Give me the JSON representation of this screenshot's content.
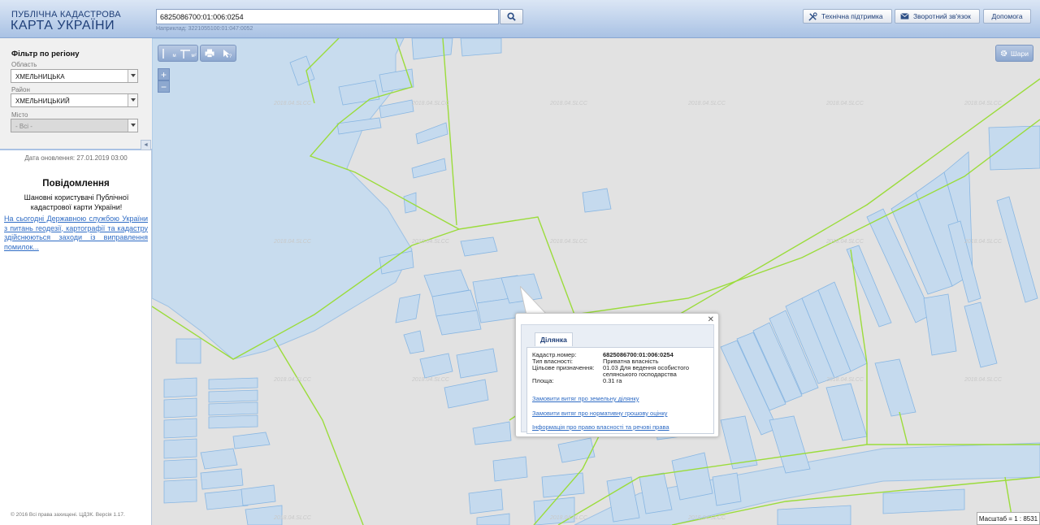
{
  "header": {
    "logo_line1": "ПУБЛІЧНА КАДАСТРОВА",
    "logo_line2": "КАРТА УКРАЇНИ",
    "search_value": "6825086700:01:006:0254",
    "search_example": "Наприклад: 3221055100:01:047:0052",
    "buttons": {
      "support": "Технічна підтримка",
      "feedback": "Зворотний зв'язок",
      "help": "Допомога"
    }
  },
  "sidebar": {
    "filter_title": "Фільтр по регіону",
    "region_label": "Область",
    "region_value": "ХМЕЛЬНИЦЬКА",
    "district_label": "Район",
    "district_value": "ХМЕЛЬНИЦЬКИЙ",
    "city_label": "Місто",
    "city_value": "- Всі -",
    "update_date": "Дата оновлення: 27.01.2019 03:00",
    "notice_title": "Повідомлення",
    "notice_body": "Шановні користувачі Публічної кадастрової карти України!",
    "notice_link": "На сьогодні Державною службою України з питань геодезії, картографії та кадастру здійснюються заходи із виправлення помилок...",
    "footer": "© 2016 Всі права захищені. ЦДЗК. Версія 1.17."
  },
  "map": {
    "tools": {
      "measure_m": "м",
      "measure_m2": "м²"
    },
    "zoom_in": "+",
    "zoom_out": "−",
    "layers": "Шари",
    "watermark": "2018.04.SLCC",
    "scale": "Масштаб = 1 : 8531",
    "popup": {
      "tab": "Ділянка",
      "rows": [
        {
          "key": "Кадастр.номер:",
          "value": "6825086700:01:006:0254"
        },
        {
          "key": "Тип власності:",
          "value": "Приватна власність"
        },
        {
          "key": "Цільове призначення:",
          "value": "01.03 Для ведення особистого селянського господарства"
        },
        {
          "key": "Площа:",
          "value": "0.31 га"
        }
      ],
      "links": [
        "Замовити витяг про земельну ділянку",
        "Замовити витяг про нормативну грошову оцінку",
        "Інформація про право власності та речові права"
      ]
    }
  },
  "colors": {
    "header_top": "#dbe6f5",
    "header_bottom": "#a9c2e4",
    "parcel_fill": "#c5daee",
    "parcel_stroke": "#88b6e2",
    "boundary": "#9bdc3b",
    "link": "#2f6cc5"
  },
  "icons": [
    "search-icon",
    "tools-icon",
    "envelope-icon",
    "ruler-icon",
    "area-icon",
    "print-icon",
    "pointer-icon",
    "gear-icon",
    "close-icon",
    "chevron-down-icon"
  ]
}
